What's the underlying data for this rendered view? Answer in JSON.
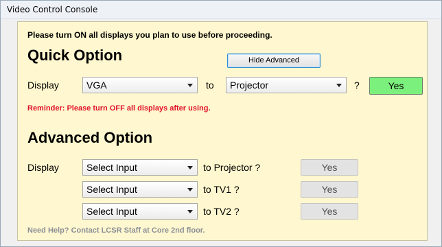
{
  "window": {
    "title": "Video Control Console"
  },
  "instruction": "Please turn ON all displays you plan to use before proceeding.",
  "quick": {
    "heading": "Quick Option",
    "hide_button": "Hide Advanced",
    "display_label": "Display",
    "source": "VGA",
    "to": "to",
    "target": "Projector",
    "question": "?",
    "yes": "Yes",
    "reminder": "Reminder: Please turn OFF all displays after using."
  },
  "advanced": {
    "heading": "Advanced Option",
    "display_label": "Display",
    "rows": [
      {
        "input": "Select Input",
        "target": "to Projector ?",
        "yes": "Yes"
      },
      {
        "input": "Select Input",
        "target": "to TV1 ?",
        "yes": "Yes"
      },
      {
        "input": "Select Input",
        "target": "to TV2 ?",
        "yes": "Yes"
      }
    ]
  },
  "help": "Need Help? Contact LCSR Staff at Core 2nd floor.",
  "colors": {
    "panel": "#fff7cf",
    "yes_active": "#7cf07c",
    "reminder": "#e0102a",
    "help": "#8a8f96"
  }
}
